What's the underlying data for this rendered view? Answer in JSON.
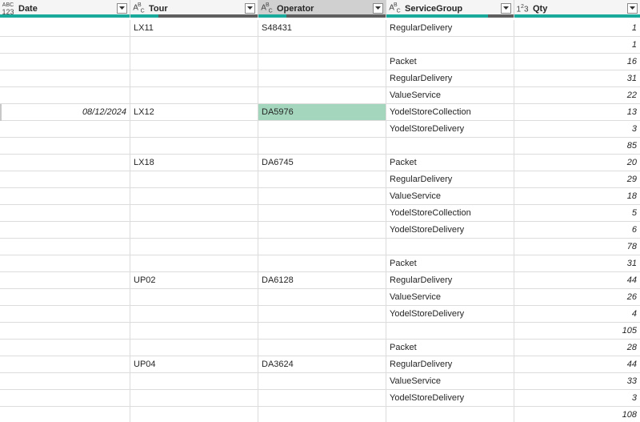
{
  "columns": [
    {
      "name": "Date",
      "type": "any",
      "icon": "abc123-type-icon"
    },
    {
      "name": "Tour",
      "type": "text",
      "icon": "abc-type-icon"
    },
    {
      "name": "Operator",
      "type": "text",
      "icon": "abc-type-icon"
    },
    {
      "name": "ServiceGroup",
      "type": "text",
      "icon": "abc-type-icon"
    },
    {
      "name": "Qty",
      "type": "integer",
      "icon": "123-type-icon"
    }
  ],
  "colors": {
    "valid": "#1aaa9b",
    "empty": "#5f5f5f",
    "selected_cell": "#a3d6bd"
  },
  "rows": [
    {
      "date": "",
      "tour": "LX11",
      "operator": "S48431",
      "service": "RegularDelivery",
      "qty": "1"
    },
    {
      "date": "",
      "tour": "",
      "operator": "",
      "service": "",
      "qty": "1"
    },
    {
      "date": "",
      "tour": "",
      "operator": "",
      "service": "Packet",
      "qty": "16"
    },
    {
      "date": "",
      "tour": "",
      "operator": "",
      "service": "RegularDelivery",
      "qty": "31"
    },
    {
      "date": "",
      "tour": "",
      "operator": "",
      "service": "ValueService",
      "qty": "22"
    },
    {
      "date": "08/12/2024",
      "tour": "LX12",
      "operator": "DA5976",
      "service": "YodelStoreCollection",
      "qty": "13",
      "highlight": true
    },
    {
      "date": "",
      "tour": "",
      "operator": "",
      "service": "YodelStoreDelivery",
      "qty": "3"
    },
    {
      "date": "",
      "tour": "",
      "operator": "",
      "service": "",
      "qty": "85"
    },
    {
      "date": "",
      "tour": "LX18",
      "operator": "DA6745",
      "service": "Packet",
      "qty": "20"
    },
    {
      "date": "",
      "tour": "",
      "operator": "",
      "service": "RegularDelivery",
      "qty": "29"
    },
    {
      "date": "",
      "tour": "",
      "operator": "",
      "service": "ValueService",
      "qty": "18"
    },
    {
      "date": "",
      "tour": "",
      "operator": "",
      "service": "YodelStoreCollection",
      "qty": "5"
    },
    {
      "date": "",
      "tour": "",
      "operator": "",
      "service": "YodelStoreDelivery",
      "qty": "6"
    },
    {
      "date": "",
      "tour": "",
      "operator": "",
      "service": "",
      "qty": "78"
    },
    {
      "date": "",
      "tour": "",
      "operator": "",
      "service": "Packet",
      "qty": "31"
    },
    {
      "date": "",
      "tour": "UP02",
      "operator": "DA6128",
      "service": "RegularDelivery",
      "qty": "44"
    },
    {
      "date": "",
      "tour": "",
      "operator": "",
      "service": "ValueService",
      "qty": "26"
    },
    {
      "date": "",
      "tour": "",
      "operator": "",
      "service": "YodelStoreDelivery",
      "qty": "4"
    },
    {
      "date": "",
      "tour": "",
      "operator": "",
      "service": "",
      "qty": "105"
    },
    {
      "date": "",
      "tour": "",
      "operator": "",
      "service": "Packet",
      "qty": "28"
    },
    {
      "date": "",
      "tour": "UP04",
      "operator": "DA3624",
      "service": "RegularDelivery",
      "qty": "44"
    },
    {
      "date": "",
      "tour": "",
      "operator": "",
      "service": "ValueService",
      "qty": "33"
    },
    {
      "date": "",
      "tour": "",
      "operator": "",
      "service": "YodelStoreDelivery",
      "qty": "3"
    },
    {
      "date": "",
      "tour": "",
      "operator": "",
      "service": "",
      "qty": "108"
    }
  ]
}
